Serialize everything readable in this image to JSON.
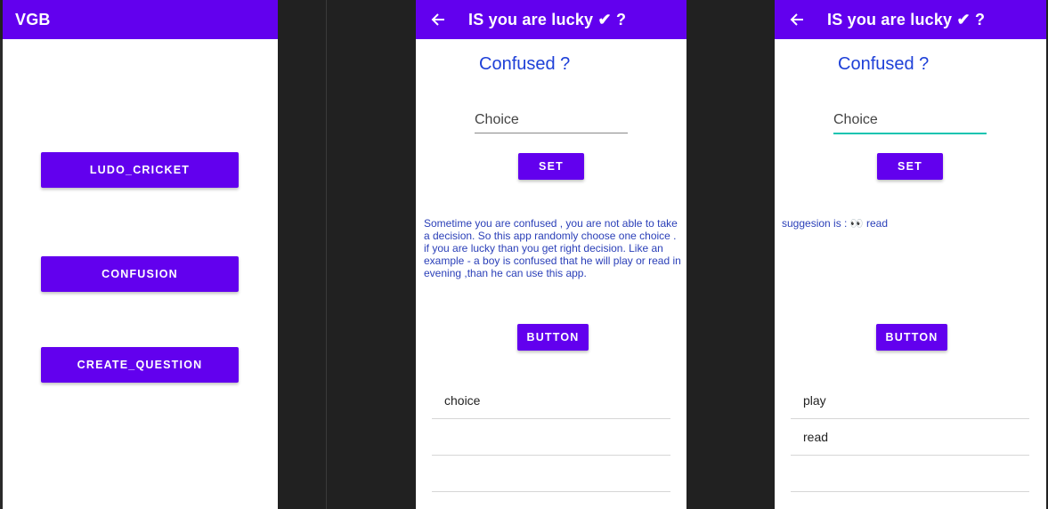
{
  "screen_home": {
    "title": "VGB",
    "buttons": [
      "LUDO_CRICKET",
      "CONFUSION",
      "CREATE_QUESTION"
    ]
  },
  "screen_confusion": {
    "title": "IS you are lucky ✔ ?",
    "heading": "Confused ?",
    "choice_placeholder": "Choice",
    "set_label": "SET",
    "description": "Sometime you are confused , you are not able to take a decision. So this app randomly choose one choice . if you are lucky than you get right decision. Like an example  - a boy is confused that he will  play or read in evening ,than he can use this app.",
    "button_label": "BUTTON",
    "list_items": [
      "choice",
      "",
      ""
    ]
  },
  "screen_result": {
    "title": "IS you are lucky ✔ ?",
    "heading": "Confused ?",
    "choice_placeholder": "Choice",
    "set_label": "SET",
    "suggestion": "suggesion is : 👀 read",
    "button_label": "BUTTON",
    "list_items": [
      "play",
      "read",
      ""
    ]
  },
  "colors": {
    "accent": "#6200ee",
    "heading": "#1e40d8",
    "focus_underline": "#14c4b0",
    "background": "#212121"
  }
}
